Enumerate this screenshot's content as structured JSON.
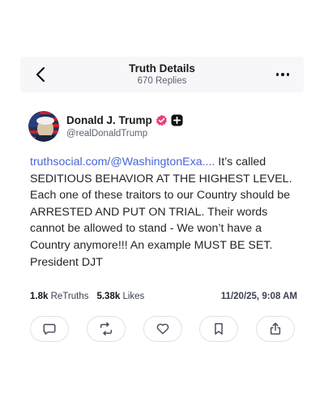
{
  "header": {
    "title": "Truth Details",
    "subtitle": "670 Replies",
    "back_icon": "chevron-left-icon",
    "more_icon": "ellipsis-icon"
  },
  "author": {
    "name": "Donald J. Trump",
    "handle": "@realDonaldTrump",
    "verified_color": "#e8417b"
  },
  "post": {
    "link_text": "truthsocial.com/@WashingtonExa....",
    "body": " It’s called SEDITIOUS BEHAVIOR AT THE HIGHEST LEVEL. Each one of these traitors to our Country should be ARRESTED AND PUT ON TRIAL. Their words cannot be allowed to stand - We won’t have a Country anymore!!! An example MUST BE SET. President DJT",
    "link_color": "#4a64d8"
  },
  "stats": {
    "retruths_count": "1.8k",
    "retruths_label": "ReTruths",
    "likes_count": "5.38k",
    "likes_label": "Likes",
    "timestamp": "11/20/25, 9:08 AM"
  },
  "actions": [
    "reply-icon",
    "retruth-icon",
    "like-icon",
    "bookmark-icon",
    "share-icon"
  ]
}
